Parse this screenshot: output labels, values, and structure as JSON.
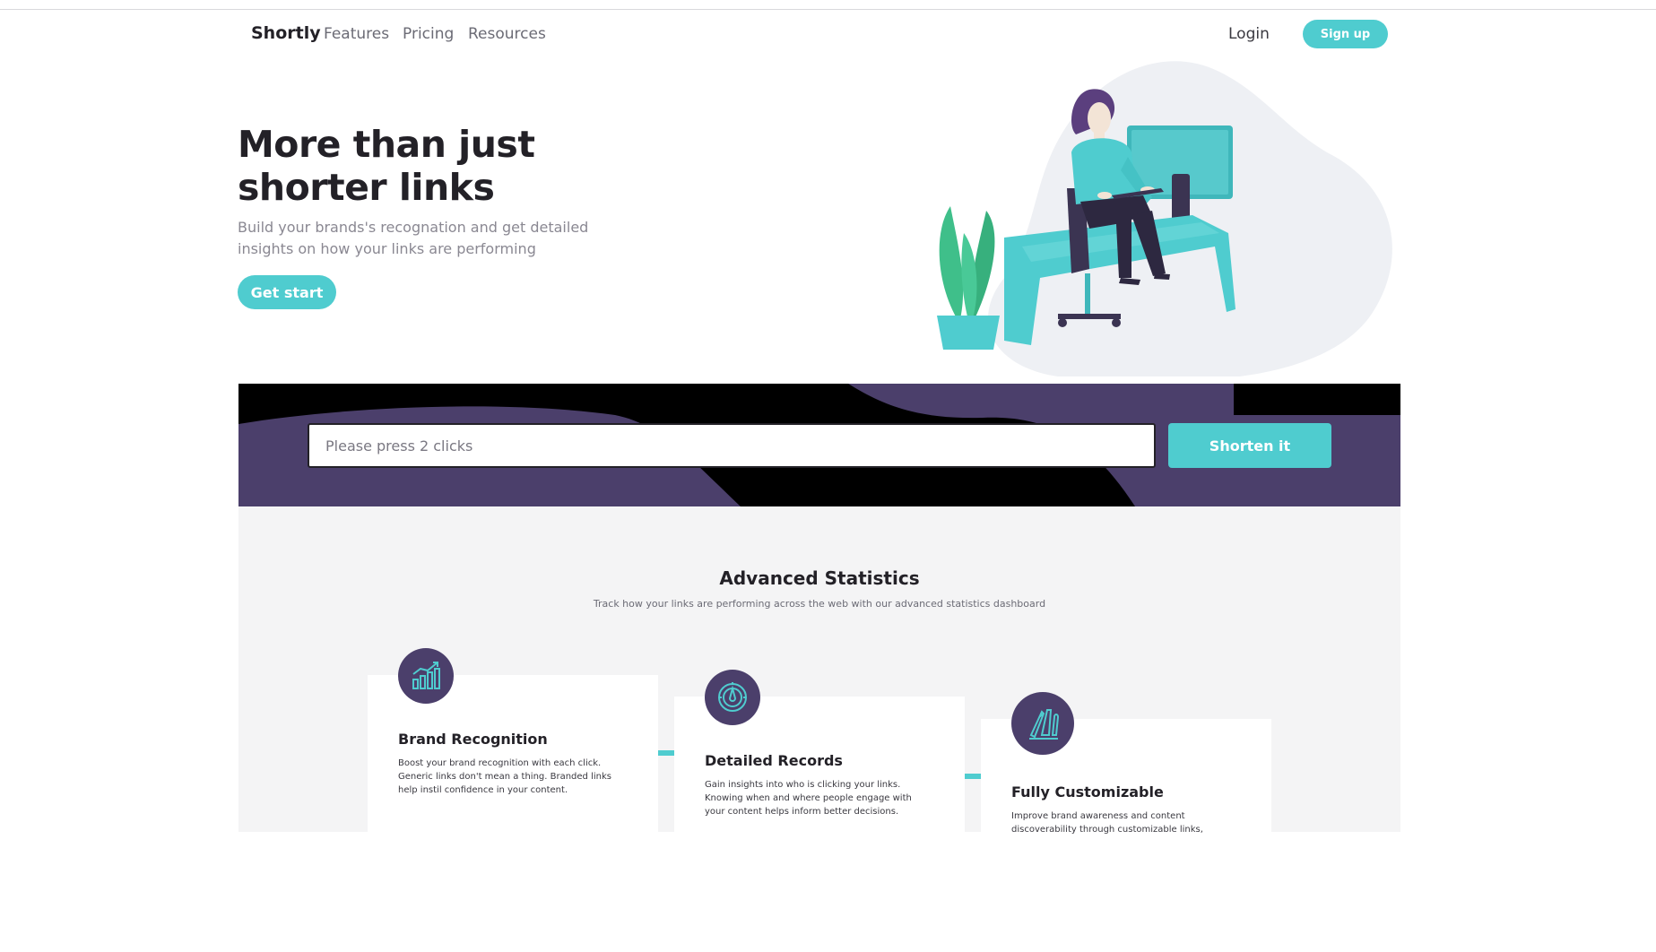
{
  "nav": {
    "logo": "Shortly",
    "links": [
      "Features",
      "Pricing",
      "Resources"
    ],
    "login": "Login",
    "signup": "Sign up"
  },
  "hero": {
    "title": "More than just shorter links",
    "subtitle": "Build your brands's recognation and get detailed insights on how your links are performing",
    "cta": "Get start",
    "illustration_icon": "person-working-at-desk-illustration"
  },
  "shorten": {
    "placeholder": "Please press 2 clicks",
    "value": "",
    "button": "Shorten it"
  },
  "stats": {
    "title": "Advanced Statistics",
    "subtitle": "Track how your links are performing across the web with our advanced statistics dashboard",
    "cards": [
      {
        "icon": "bar-chart-icon",
        "title": "Brand Recognition",
        "text": "Boost your brand recognition with each click. Generic links don't mean a thing. Branded links help instil confidence in your content."
      },
      {
        "icon": "gauge-icon",
        "title": "Detailed Records",
        "text": "Gain insights into who is clicking your links. Knowing when and where people engage with your content helps inform better decisions."
      },
      {
        "icon": "pen-brush-tools-icon",
        "title": "Fully Customizable",
        "text": "Improve brand awareness and content discoverability through customizable links,"
      }
    ]
  },
  "colors": {
    "accent": "#4fcccf",
    "dark_violet": "#4b3f6b",
    "text_dark": "#232127",
    "text_gray": "#8a8892",
    "stats_bg": "#f4f4f5"
  }
}
